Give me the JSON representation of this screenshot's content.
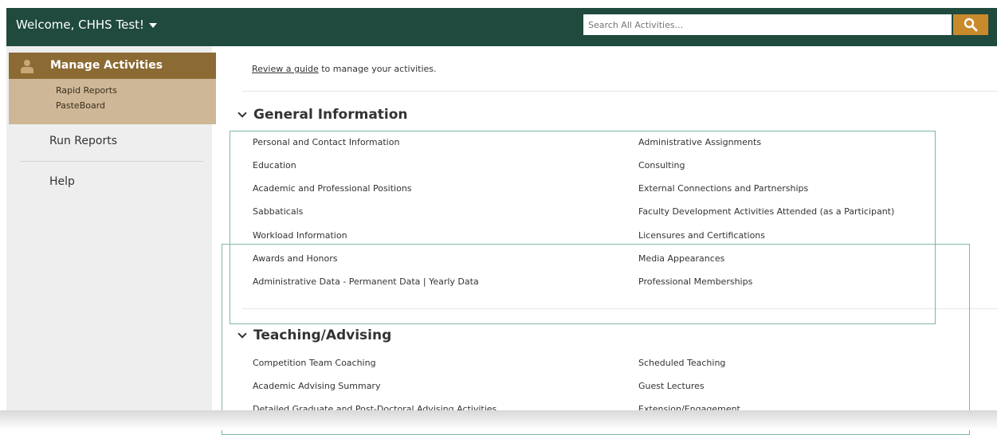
{
  "header": {
    "welcome": "Welcome, CHHS Test!",
    "search_placeholder": "Search All Activities..."
  },
  "sidebar": {
    "active": "Manage Activities",
    "sub": [
      "Rapid Reports",
      "PasteBoard"
    ],
    "items": [
      "Run Reports",
      "Help"
    ]
  },
  "main": {
    "intro_link": "Review a guide",
    "intro_rest": " to manage your activities.",
    "sections": [
      {
        "title": "General Information",
        "left": [
          "Personal and Contact Information",
          "Education",
          "Academic and Professional Positions",
          "Sabbaticals",
          "Workload Information",
          "Awards and Honors",
          "Administrative Data - Permanent Data | Yearly Data"
        ],
        "right": [
          "Administrative Assignments",
          "Consulting",
          "External Connections and Partnerships",
          "Faculty Development Activities Attended (as a Participant)",
          "Licensures and Certifications",
          "Media Appearances",
          "Professional Memberships"
        ]
      },
      {
        "title": "Teaching/Advising",
        "left": [
          "Competition Team Coaching",
          "Academic Advising Summary",
          "Detailed Graduate and Post-Doctoral Advising Activities"
        ],
        "right": [
          "Scheduled Teaching",
          "Guest Lectures",
          "Extension/Engagement"
        ]
      }
    ]
  },
  "colors": {
    "header": "#1f4a3d",
    "accent_orange": "#c98a2c",
    "nav_active": "#8b6a34",
    "nav_sub": "#cdb796"
  }
}
